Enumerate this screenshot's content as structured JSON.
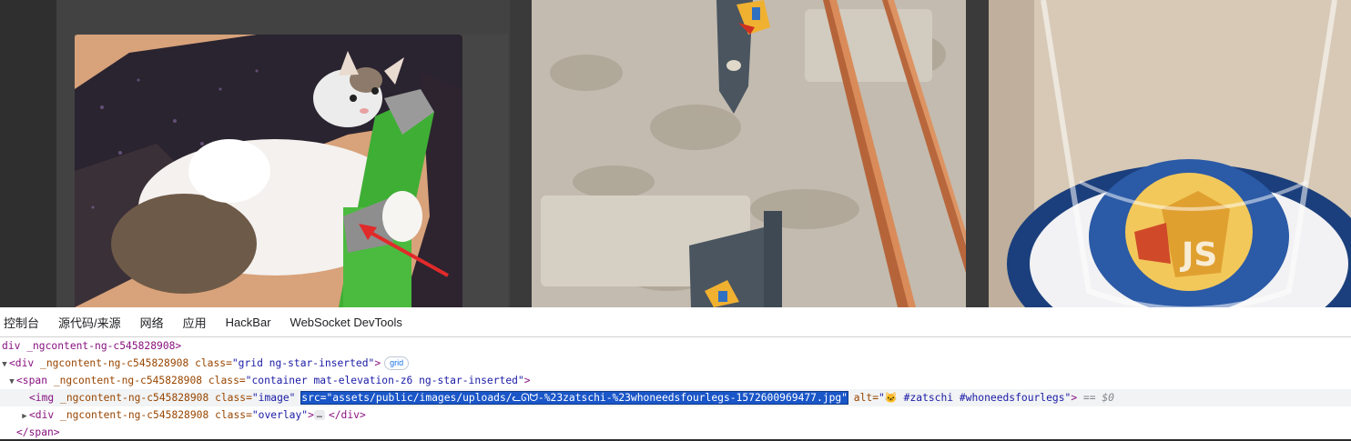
{
  "devtools": {
    "tabs": [
      "控制台",
      "源代码/来源",
      "网络",
      "应用",
      "HackBar",
      "WebSocket DevTools"
    ],
    "lines": [
      {
        "indent": 0,
        "parts": [
          {
            "t": "div _ngcontent-ng-c545828908>",
            "c": "tag"
          }
        ]
      },
      {
        "indent": 0,
        "toggle": "▼",
        "parts": [
          {
            "t": "<div ",
            "c": "tag"
          },
          {
            "t": "_ngcontent-ng-c545828908 ",
            "c": "an"
          },
          {
            "t": "class=",
            "c": "an"
          },
          {
            "t": "\"grid ng-star-inserted\"",
            "c": "av"
          },
          {
            "t": ">",
            "c": "tag"
          }
        ],
        "badge": "grid"
      },
      {
        "indent": 1,
        "toggle": "▼",
        "parts": [
          {
            "t": "<span ",
            "c": "tag"
          },
          {
            "t": "_ngcontent-ng-c545828908 ",
            "c": "an"
          },
          {
            "t": "class=",
            "c": "an"
          },
          {
            "t": "\"container mat-elevation-z6 ng-star-inserted\"",
            "c": "av"
          },
          {
            "t": ">",
            "c": "tag"
          }
        ]
      },
      {
        "indent": 2,
        "selected": true,
        "parts": [
          {
            "t": "<img ",
            "c": "tag"
          },
          {
            "t": "_ngcontent-ng-c545828908 ",
            "c": "an"
          },
          {
            "t": "class=",
            "c": "an"
          },
          {
            "t": "\"image\" ",
            "c": "av"
          },
          {
            "t": "src=\"assets/public/images/uploads/ᓚᘏᗢ-%23zatschi-%23whoneedsfourlegs-1572600969477.jpg\"",
            "c": "hl"
          },
          {
            "t": " alt=",
            "c": "an"
          },
          {
            "t": "\"🐱 #zatschi #whoneedsfourlegs\"",
            "c": "av"
          },
          {
            "t": "> ",
            "c": "tag"
          },
          {
            "t": "== $0",
            "c": "eq"
          }
        ]
      },
      {
        "indent": 2,
        "toggle": "▶",
        "parts": [
          {
            "t": "<div ",
            "c": "tag"
          },
          {
            "t": "_ngcontent-ng-c545828908 ",
            "c": "an"
          },
          {
            "t": "class=",
            "c": "an"
          },
          {
            "t": "\"overlay\"",
            "c": "av"
          },
          {
            "t": ">",
            "c": "tag"
          }
        ],
        "ellipsis": "…",
        "after": "</div>"
      },
      {
        "indent": 1,
        "parts": [
          {
            "t": "</span>",
            "c": "tag"
          }
        ]
      }
    ]
  }
}
